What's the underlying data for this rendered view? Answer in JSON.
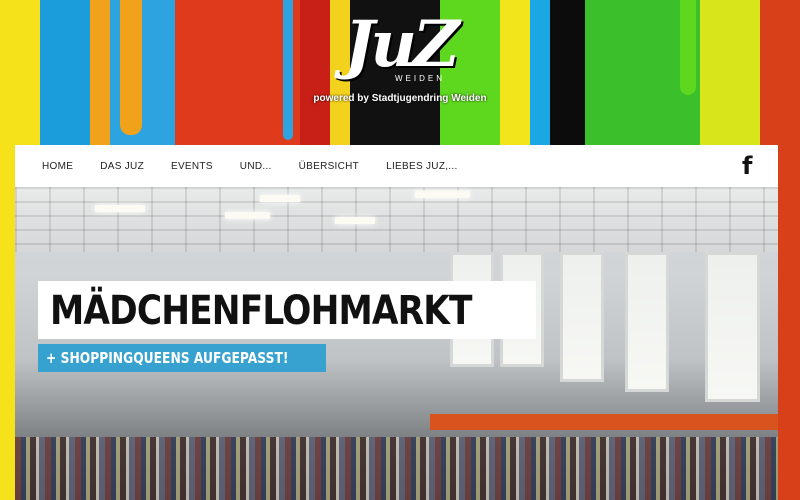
{
  "header": {
    "logo_text": "JuZ",
    "logo_sub": "WEIDEN",
    "tagline": "powered by Stadtjugendring Weiden"
  },
  "nav": {
    "items": [
      {
        "label": "HOME"
      },
      {
        "label": "DAS JUZ"
      },
      {
        "label": "EVENTS"
      },
      {
        "label": "UND..."
      },
      {
        "label": "ÜBERSICHT"
      },
      {
        "label": "LIEBES JUZ,..."
      }
    ],
    "facebook_icon": "facebook-icon",
    "facebook_glyph": "f"
  },
  "hero": {
    "title": "MÄDCHENFLOHMARKT",
    "subtitle": "+ SHOPPINGQUEENS AUFGEPASST!",
    "subtitle_color": "#37a2cf"
  },
  "colors": {
    "accent_blue": "#37a2cf",
    "nav_background": "#ffffff"
  }
}
